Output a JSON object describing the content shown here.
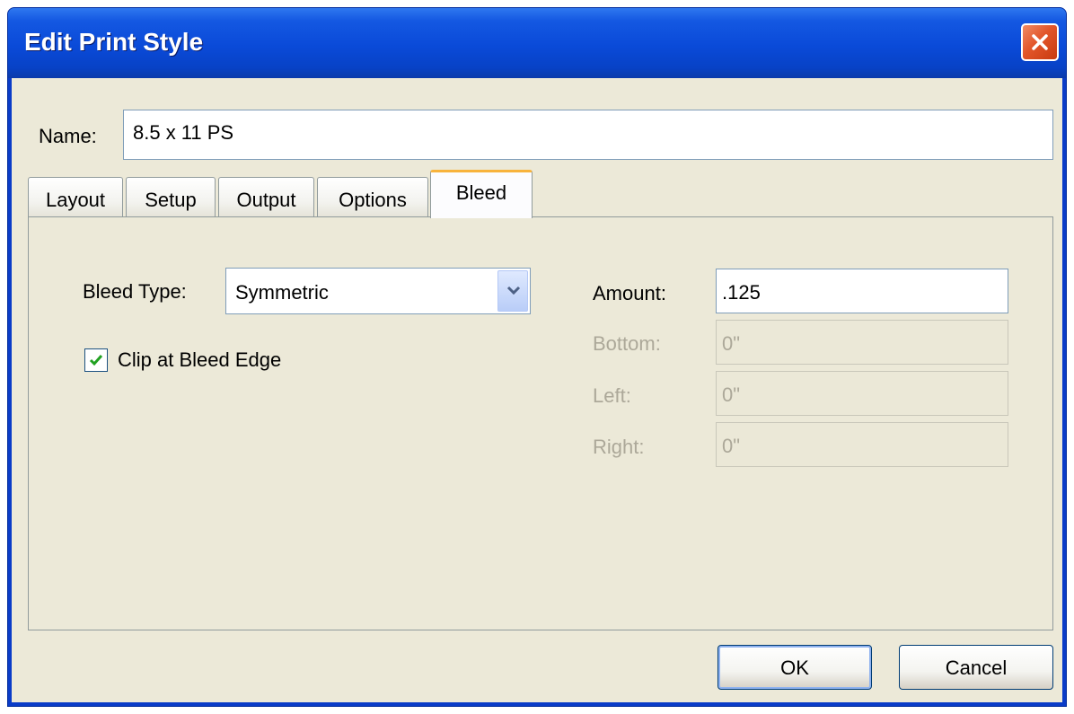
{
  "window": {
    "title": "Edit Print Style"
  },
  "name_field": {
    "label": "Name:",
    "value": "8.5 x 11 PS"
  },
  "tabs": [
    {
      "label": "Layout",
      "active": false
    },
    {
      "label": "Setup",
      "active": false
    },
    {
      "label": "Output",
      "active": false
    },
    {
      "label": "Options",
      "active": false
    },
    {
      "label": "Bleed",
      "active": true
    }
  ],
  "bleed": {
    "bleed_type_label": "Bleed Type:",
    "bleed_type_value": "Symmetric",
    "clip_label": "Clip at Bleed Edge",
    "clip_checked": true,
    "amount_label": "Amount:",
    "amount_value": ".125",
    "bottom_label": "Bottom:",
    "bottom_value": "0\"",
    "left_label": "Left:",
    "left_value": "0\"",
    "right_label": "Right:",
    "right_value": "0\""
  },
  "buttons": {
    "ok": "OK",
    "cancel": "Cancel"
  },
  "colors": {
    "titlebar": "#0a4ad8",
    "dialog_bg": "#ece9d8",
    "active_tab_accent": "#f8b33c",
    "checkmark": "#21a121",
    "disabled_text": "#aca899"
  },
  "icons": {
    "close": "close-icon",
    "dropdown": "chevron-down-icon",
    "check": "checkmark-icon"
  }
}
